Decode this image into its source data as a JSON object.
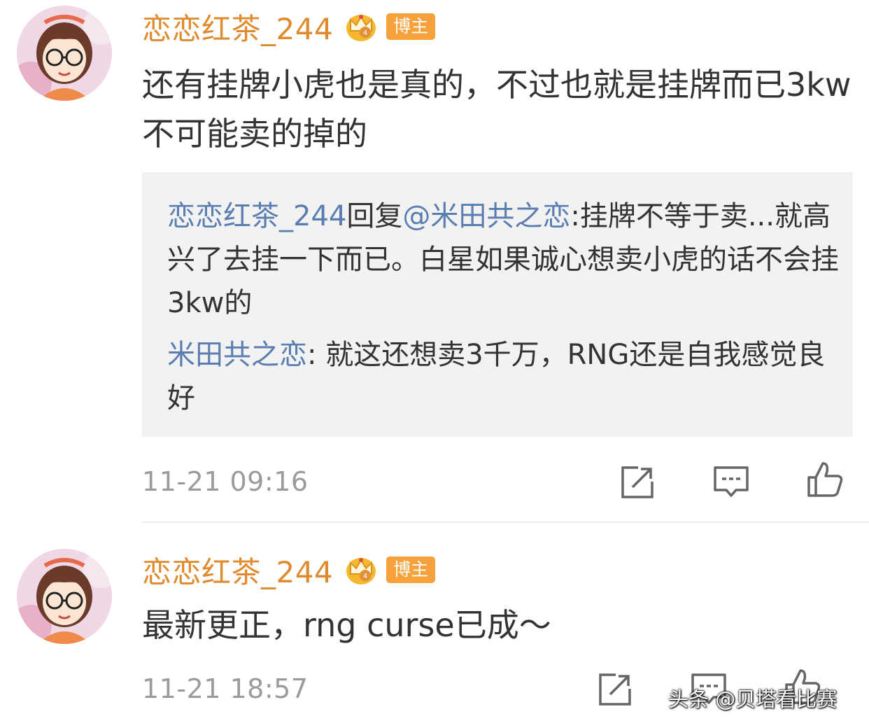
{
  "comments": [
    {
      "author": "恋恋红茶_244",
      "badge": "博主",
      "text": "还有挂牌小虎也是真的，不过也就是挂牌而已3kw不可能卖的掉的",
      "quote": {
        "reply_user": "恋恋红茶_244",
        "reply_word": "回复",
        "reply_target": "@米田共之恋",
        "reply_text": ":挂牌不等于卖...就高兴了去挂一下而已。白星如果诚心想卖小虎的话不会挂3kw的",
        "orig_user": "米田共之恋",
        "orig_text": ": 就这还想卖3千万，RNG还是自我感觉良好"
      },
      "time": "11-21 09:16"
    },
    {
      "author": "恋恋红茶_244",
      "badge": "博主",
      "text": "最新更正，rng curse已成～",
      "time": "11-21 18:57"
    }
  ],
  "watermark": "头条 @贝塔看比赛",
  "colors": {
    "author": "#e08a2e",
    "badge_bg": "#f6a13c",
    "link": "#5b7eb1",
    "time": "#9b9b9b",
    "quote_bg": "#f2f2f2"
  },
  "icons": [
    "crown-vip-icon",
    "share-icon",
    "comment-icon",
    "like-icon"
  ]
}
